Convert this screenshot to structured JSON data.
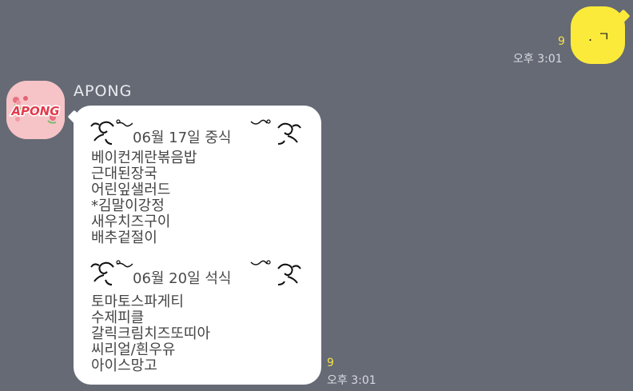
{
  "outgoing": {
    "text": ". ㄱ",
    "read_count": "9",
    "time": "오후 3:01"
  },
  "incoming": {
    "sender": "APONG",
    "avatar_text": "APONG",
    "read_count": "9",
    "time": "오후 3:01",
    "sections": [
      {
        "title": "06월 17일 중식",
        "items": [
          "베이컨계란볶음밥",
          "근대된장국",
          "어린잎샐러드",
          "*김말이강정",
          "새우치즈구이",
          "배추겉절이"
        ]
      },
      {
        "title": "06월 20일 석식",
        "items": [
          "토마토스파게티",
          "수제피클",
          "갈릭크림치즈또띠아",
          "씨리얼/흰우유",
          "아이스망고"
        ]
      }
    ]
  },
  "colors": {
    "background": "#656a75",
    "outgoing_bubble": "#fcea3b",
    "incoming_bubble": "#ffffff",
    "read_count": "#f5e14a"
  }
}
